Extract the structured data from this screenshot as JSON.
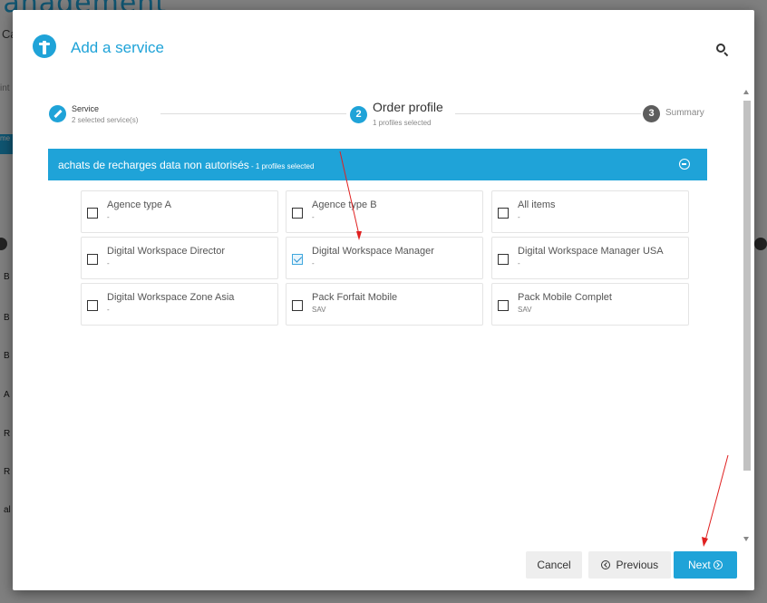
{
  "background": {
    "title": "lanagement",
    "subtitle": "Ca",
    "side_text": "int",
    "chip": "me",
    "left_letters": [
      "B",
      "B",
      "B",
      "A",
      "R",
      "R",
      "al"
    ]
  },
  "modal": {
    "title": "Add a service",
    "search_icon": "search-icon"
  },
  "stepper": {
    "steps": [
      {
        "number": "",
        "title": "Service",
        "subtitle": "2 selected service(s)",
        "state": "done"
      },
      {
        "number": "2",
        "title": "Order profile",
        "subtitle": "1 profiles selected",
        "state": "active"
      },
      {
        "number": "3",
        "title": "Summary",
        "subtitle": "",
        "state": "pending"
      }
    ]
  },
  "group": {
    "title": "achats de recharges data non autorisés",
    "count": " - 1 profiles selected",
    "toggle_icon": "collapse-circle-icon"
  },
  "profiles": [
    {
      "name": "Agence type A",
      "sub": "-",
      "checked": false
    },
    {
      "name": "Agence type B",
      "sub": "-",
      "checked": false
    },
    {
      "name": "All items",
      "sub": "-",
      "checked": false
    },
    {
      "name": "Digital Workspace Director",
      "sub": "-",
      "checked": false
    },
    {
      "name": "Digital Workspace Manager",
      "sub": "-",
      "checked": true
    },
    {
      "name": "Digital Workspace Manager USA",
      "sub": "-",
      "checked": false
    },
    {
      "name": "Digital Workspace Zone Asia",
      "sub": "-",
      "checked": false
    },
    {
      "name": "Pack Forfait Mobile",
      "sub": "SAV",
      "checked": false
    },
    {
      "name": "Pack Mobile Complet",
      "sub": "SAV",
      "checked": false
    }
  ],
  "footer": {
    "cancel_label": "Cancel",
    "previous_label": "Previous",
    "next_label": "Next"
  },
  "colors": {
    "accent": "#1fa3d8",
    "annotation": "#e02020"
  }
}
